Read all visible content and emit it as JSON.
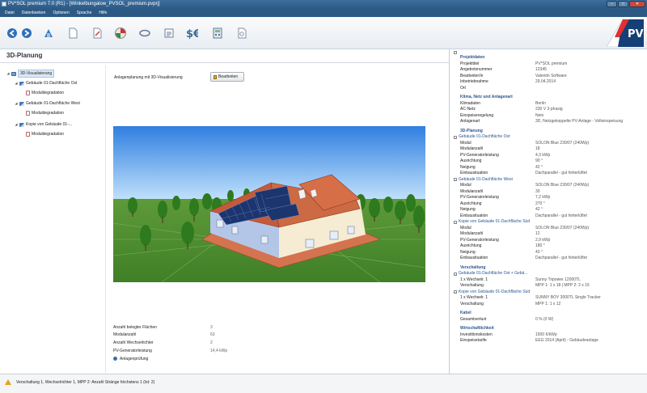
{
  "window": {
    "title": "PV*SOL premium 7.0 (R1) - [Winkelbungalow_PVSOL_premium.pvprj]"
  },
  "menu": [
    "Datei",
    "Datenbanken",
    "Optionen",
    "Sprache",
    "Hilfe"
  ],
  "toolbar": {
    "icons": [
      "back-icon",
      "forward-icon",
      "project-data-icon",
      "new-document-icon",
      "edit-document-icon",
      "3d-planning-icon",
      "connection-icon",
      "results-icon",
      "finance-icon",
      "calculator-icon",
      "report-icon"
    ]
  },
  "brand": {
    "text": "PV"
  },
  "page": {
    "title": "3D-Planung"
  },
  "tree": [
    {
      "label": "3D-Visualisierung",
      "selected": true
    },
    {
      "label": "Gebäude 01-Dachfläche Ost"
    },
    {
      "label": "Moduldegradation"
    },
    {
      "label": "Gebäude 01-Dachfläche West"
    },
    {
      "label": "Moduldegradation"
    },
    {
      "label": "Kopie von Gebäude 01-..."
    },
    {
      "label": "Moduldegradation"
    }
  ],
  "planning": {
    "label": "Anlagenplanung mit 3D-Visualisierung",
    "button": "Bearbeiten"
  },
  "stats": [
    {
      "k": "Anzahl belegter Flächen",
      "v": "3"
    },
    {
      "k": "Modulanzahl",
      "v": "63"
    },
    {
      "k": "Anzahl Wechselrichter",
      "v": "2"
    },
    {
      "k": "PV-Generatorleistung",
      "v": "14,4 kWp"
    }
  ],
  "stats_link": "Anlagenprüfung",
  "right": {
    "sections": [
      {
        "head": "Projektdaten",
        "rows": [
          [
            "Projekttitel",
            "PV*SOL premium"
          ],
          [
            "Angebotsnummer",
            "12345"
          ],
          [
            "Bearbeiter/in",
            "Valentin Software"
          ],
          [
            "Inbetriebnahme",
            "29.04.2014"
          ],
          [
            "Ort",
            ""
          ]
        ]
      },
      {
        "head": "Klima, Netz und Anlagenart",
        "rows": [
          [
            "Klimadaten",
            "Berlin"
          ],
          [
            "AC-Netz",
            "230 V 3-phasig"
          ],
          [
            "Einspeiseregelung",
            "Nein"
          ],
          [
            "Anlagenart",
            "3D, Netzgekoppelte PV-Anlage - Volleinspeisung"
          ]
        ]
      },
      {
        "head": "3D-Planung",
        "groups": [
          {
            "sub": "Gebäude 01-Dachfläche Ost",
            "rows": [
              [
                "Modul",
                "SOLON Blue 230/07 (240Wp)"
              ],
              [
                "Modulanzahl",
                "18"
              ],
              [
                "PV-Generatorleistung",
                "4,3 kWp"
              ],
              [
                "Ausrichtung",
                "90 °"
              ],
              [
                "Neigung",
                "42 °"
              ],
              [
                "Einbausituation",
                "Dachparallel - gut hinterlüftet"
              ]
            ]
          },
          {
            "sub": "Gebäude 01-Dachfläche West",
            "rows": [
              [
                "Modul",
                "SOLON Blue 230/07 (240Wp)"
              ],
              [
                "Modulanzahl",
                "30"
              ],
              [
                "PV-Generatorleistung",
                "7,2 kWp"
              ],
              [
                "Ausrichtung",
                "270 °"
              ],
              [
                "Neigung",
                "42 °"
              ],
              [
                "Einbausituation",
                "Dachparallel - gut hinterlüftet"
              ]
            ]
          },
          {
            "sub": "Kopie von Gebäude 01-Dachfläche Süd",
            "rows": [
              [
                "Modul",
                "SOLON Blue 230/07 (240Wp)"
              ],
              [
                "Modulanzahl",
                "12"
              ],
              [
                "PV-Generatorleistung",
                "2,9 kWp"
              ],
              [
                "Ausrichtung",
                "180 °"
              ],
              [
                "Neigung",
                "43 °"
              ],
              [
                "Einbausituation",
                "Dachparallel - gut hinterlüftet"
              ]
            ]
          }
        ]
      },
      {
        "head": "Verschaltung",
        "groups": [
          {
            "sub": "Gebäude 01-Dachfläche Ost + Gebä...",
            "rows": [
              [
                "1 x Wechselr. 1",
                "Sunny Tripower 12000TL"
              ],
              [
                "Verschaltung",
                "MPP 1: 1 x 18 | MPP 2: 2 x 15"
              ]
            ]
          },
          {
            "sub": "Kopie von Gebäude 01-Dachfläche Süd",
            "rows": [
              [
                "1 x Wechselr. 1",
                "SUNNY BOY 3000TL Single Tracker"
              ],
              [
                "Verschaltung",
                "MPP 1: 1 x 12"
              ]
            ]
          }
        ]
      },
      {
        "head": "Kabel",
        "rows": [
          [
            "Gesamtverlust",
            "0 % (0 W)"
          ]
        ]
      },
      {
        "head": "Wirtschaftlichkeit",
        "rows": [
          [
            "Investitionskosten",
            "1500 €/kWp"
          ],
          [
            "Einspeisetarife",
            "EEG 2014 (April) - Gebäudeanlage"
          ]
        ]
      }
    ]
  },
  "status": {
    "message": "Verschaltung 1, Wechselrichter 1, MPP 2:   Anzahl Stränge höchstens 1 (Ist: 2)"
  },
  "colors": {
    "titlebar": "#2c5a86",
    "accent": "#2a5590",
    "sky": "#4a8fe0",
    "grass": "#4a8a2e",
    "roof": "#c8553a",
    "panels": "#1f3a7a",
    "warning": "#e8a020"
  }
}
